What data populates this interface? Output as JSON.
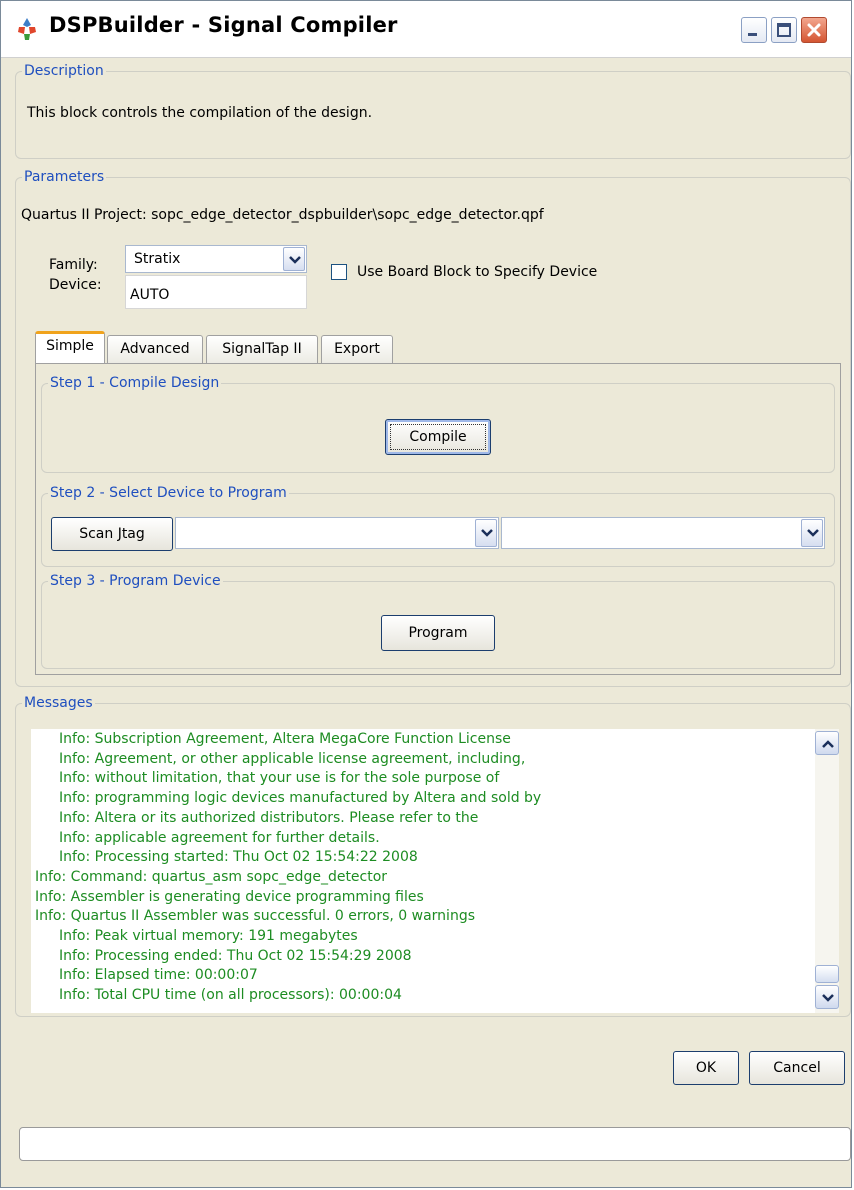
{
  "window": {
    "title": "DSPBuilder - Signal Compiler",
    "icon": "dspbuilder-app-icon",
    "controls": [
      "minimize-icon",
      "maximize-icon",
      "close-icon"
    ]
  },
  "description": {
    "legend": "Description",
    "text": "This block controls the compilation of the design."
  },
  "parameters": {
    "legend": "Parameters",
    "project_line": "Quartus II Project: sopc_edge_detector_dspbuilder\\sopc_edge_detector.qpf",
    "family_label": "Family:",
    "family_value": "Stratix",
    "device_label": "Device:",
    "device_value": "AUTO",
    "board_block_label": "Use Board Block to Specify Device",
    "board_block_checked": false
  },
  "tabs": [
    {
      "label": "Simple",
      "active": true
    },
    {
      "label": "Advanced",
      "active": false
    },
    {
      "label": "SignalTap II",
      "active": false
    },
    {
      "label": "Export",
      "active": false
    }
  ],
  "step1": {
    "legend": "Step 1 - Compile Design",
    "button": "Compile"
  },
  "step2": {
    "legend": "Step 2 - Select Device to Program",
    "button": "Scan Jtag",
    "select1_value": "",
    "select2_value": ""
  },
  "step3": {
    "legend": "Step 3 - Program Device",
    "button": "Program"
  },
  "messages": {
    "legend": "Messages",
    "color": "#1d8c22",
    "lines": [
      {
        "text": "Info: Subscription Agreement, Altera MegaCore Function License",
        "indent": true
      },
      {
        "text": "Info: Agreement, or other applicable license agreement, including,",
        "indent": true
      },
      {
        "text": "Info: without limitation, that your use is for the sole purpose of",
        "indent": true
      },
      {
        "text": "Info: programming logic devices manufactured by Altera and sold by",
        "indent": true
      },
      {
        "text": "Info: Altera or its authorized distributors.  Please refer to the",
        "indent": true
      },
      {
        "text": "Info: applicable agreement for further details.",
        "indent": true
      },
      {
        "text": "Info: Processing started: Thu Oct 02 15:54:22 2008",
        "indent": true
      },
      {
        "text": "Info: Command: quartus_asm sopc_edge_detector",
        "indent": false
      },
      {
        "text": "Info: Assembler is generating device programming files",
        "indent": false
      },
      {
        "text": "Info: Quartus II Assembler was successful. 0 errors, 0 warnings",
        "indent": false
      },
      {
        "text": "Info: Peak virtual memory: 191 megabytes",
        "indent": true
      },
      {
        "text": "Info: Processing ended: Thu Oct 02 15:54:29 2008",
        "indent": true
      },
      {
        "text": "Info: Elapsed time: 00:00:07",
        "indent": true
      },
      {
        "text": "Info: Total CPU time (on all processors): 00:00:04",
        "indent": true
      }
    ]
  },
  "footer": {
    "ok": "OK",
    "cancel": "Cancel",
    "status_text": ""
  }
}
